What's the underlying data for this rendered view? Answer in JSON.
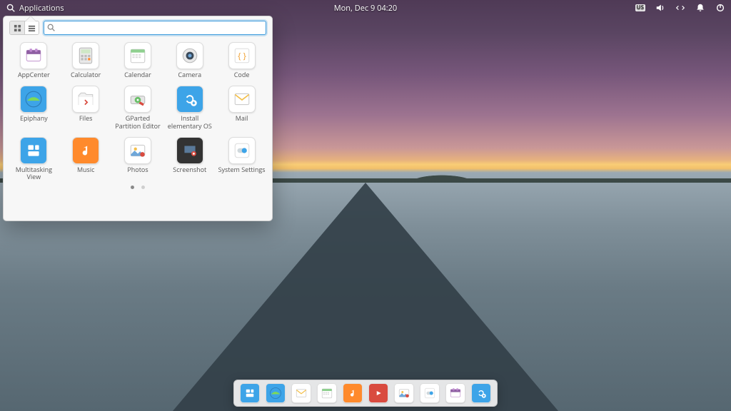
{
  "panel": {
    "applications_label": "Applications",
    "datetime": "Mon, Dec 9   04:20",
    "keyboard_layout": "US"
  },
  "app_menu": {
    "search_placeholder": "",
    "pages": {
      "count": 2,
      "active": 0
    },
    "apps": [
      {
        "label": "AppCenter",
        "icon": "appcenter",
        "bg": "#ffffff"
      },
      {
        "label": "Calculator",
        "icon": "calculator",
        "bg": "#ffffff"
      },
      {
        "label": "Calendar",
        "icon": "calendar",
        "bg": "#ffffff"
      },
      {
        "label": "Camera",
        "icon": "camera",
        "bg": "#ffffff"
      },
      {
        "label": "Code",
        "icon": "code",
        "bg": "#ffffff"
      },
      {
        "label": "Epiphany",
        "icon": "epiphany",
        "bg": "#3da4e8"
      },
      {
        "label": "Files",
        "icon": "files",
        "bg": "#ffffff"
      },
      {
        "label": "GParted Partition Editor",
        "icon": "gparted",
        "bg": "#ffffff"
      },
      {
        "label": "Install elementary OS",
        "icon": "installer",
        "bg": "#3da4e8"
      },
      {
        "label": "Mail",
        "icon": "mail",
        "bg": "#ffffff"
      },
      {
        "label": "Multitasking View",
        "icon": "multitask",
        "bg": "#3da4e8"
      },
      {
        "label": "Music",
        "icon": "music",
        "bg": "#ff8a2c"
      },
      {
        "label": "Photos",
        "icon": "photos",
        "bg": "#ffffff"
      },
      {
        "label": "Screenshot",
        "icon": "screenshot",
        "bg": "#333333"
      },
      {
        "label": "System Settings",
        "icon": "settings",
        "bg": "#ffffff"
      }
    ]
  },
  "dock": {
    "items": [
      {
        "name": "multitask",
        "bg": "#3da4e8"
      },
      {
        "name": "epiphany",
        "bg": "#3da4e8"
      },
      {
        "name": "mail",
        "bg": "#ffffff"
      },
      {
        "name": "calendar",
        "bg": "#ffffff"
      },
      {
        "name": "music",
        "bg": "#ff8a2c"
      },
      {
        "name": "videos",
        "bg": "#d94b3f"
      },
      {
        "name": "photos",
        "bg": "#ffffff"
      },
      {
        "name": "settings",
        "bg": "#ffffff"
      },
      {
        "name": "appcenter",
        "bg": "#ffffff"
      },
      {
        "name": "installer",
        "bg": "#3da4e8"
      }
    ]
  }
}
